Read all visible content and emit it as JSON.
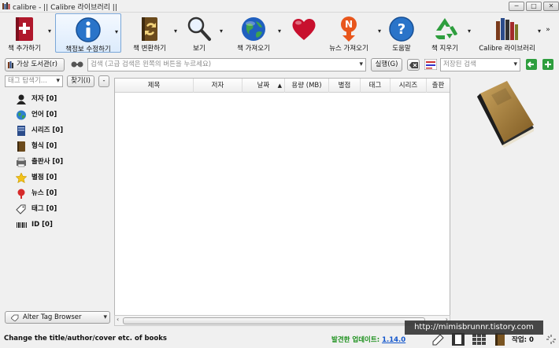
{
  "window": {
    "title": "calibre - || Calibre 라이브러리 ||",
    "controls": {
      "minimize": "─",
      "maximize": "□",
      "close": "✕"
    }
  },
  "toolbar": {
    "add_books": "책 추가하기",
    "edit_metadata": "책정보 수정하기",
    "convert_books": "책 변환하기",
    "view": "보기",
    "get_books": "책 가져오기",
    "fetch_news": "뉴스 가져오기",
    "help": "도움말",
    "remove_books": "책 지우기",
    "library": "Calibre 라이브러리",
    "overflow": "»"
  },
  "search": {
    "virtual_library": "가상 도서관(r)",
    "placeholder": "검색 (고급 검색은 왼쪽의 버튼을 누르세요)",
    "go_button": "실행(G)",
    "saved_search_placeholder": "저장된 검색"
  },
  "tag_browser": {
    "filter_placeholder": "태그 탐색기...",
    "find_button": "찾기(I)",
    "collapse_button": "-",
    "items": [
      {
        "label": "저자 [0]",
        "icon": "user-icon"
      },
      {
        "label": "언어 [0]",
        "icon": "globe-icon"
      },
      {
        "label": "시리즈 [0]",
        "icon": "series-icon"
      },
      {
        "label": "형식 [0]",
        "icon": "book-format-icon"
      },
      {
        "label": "출판사 [0]",
        "icon": "publisher-icon"
      },
      {
        "label": "별점 [0]",
        "icon": "star-icon"
      },
      {
        "label": "뉴스 [0]",
        "icon": "news-icon"
      },
      {
        "label": "태그 [0]",
        "icon": "tag-icon"
      },
      {
        "label": "ID [0]",
        "icon": "barcode-icon"
      }
    ],
    "alter_button": "Alter Tag Browser"
  },
  "table": {
    "columns": [
      "제목",
      "저자",
      "날짜",
      "용량 (MB)",
      "별점",
      "태그",
      "시리즈",
      "출판"
    ]
  },
  "status": {
    "message": "Change the title/author/cover etc. of books",
    "update_label": "발견한 업데이트:",
    "update_version": "1.14.0",
    "jobs": "작업: 0"
  },
  "watermark": "http://mimisbrunnr.tistory.com",
  "colors": {
    "accent": "#7aa7d8",
    "update_green": "#1a8f1a",
    "link_blue": "#1155cc"
  }
}
